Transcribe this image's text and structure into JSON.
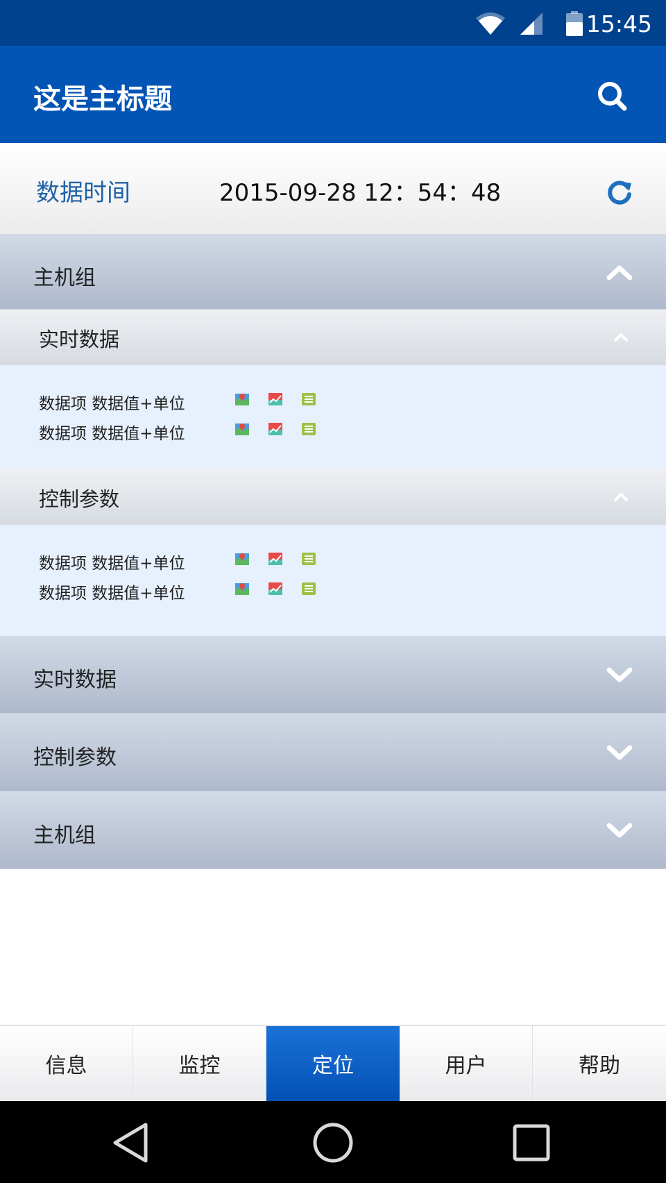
{
  "status_bar": {
    "time": "15:45",
    "icons": [
      "wifi-icon",
      "cell-signal-icon",
      "battery-icon"
    ]
  },
  "app_bar": {
    "title": "这是主标题",
    "search_icon": "search-icon"
  },
  "data_time": {
    "label": "数据时间",
    "value": "2015-09-28 12：54：48",
    "refresh_icon": "refresh-icon"
  },
  "expanded_group": {
    "label": "主机组",
    "sections": [
      {
        "label": "实时数据",
        "items": [
          {
            "text": "数据项 数据值+单位"
          },
          {
            "text": "数据项 数据值+单位"
          }
        ]
      },
      {
        "label": "控制参数",
        "items": [
          {
            "text": "数据项 数据值+单位"
          },
          {
            "text": "数据项 数据值+单位"
          }
        ]
      }
    ]
  },
  "collapsed_groups": [
    {
      "label": "实时数据"
    },
    {
      "label": "控制参数"
    },
    {
      "label": "主机组"
    }
  ],
  "bottom_nav": {
    "active_index": 2,
    "tabs": [
      {
        "label": "信息"
      },
      {
        "label": "监控"
      },
      {
        "label": "定位"
      },
      {
        "label": "用户"
      },
      {
        "label": "帮助"
      }
    ]
  },
  "colors": {
    "primary": "#0255b5",
    "status_bar": "#01428f",
    "accent_text": "#1f62a8",
    "panel_bg": "#e7f0fd"
  }
}
